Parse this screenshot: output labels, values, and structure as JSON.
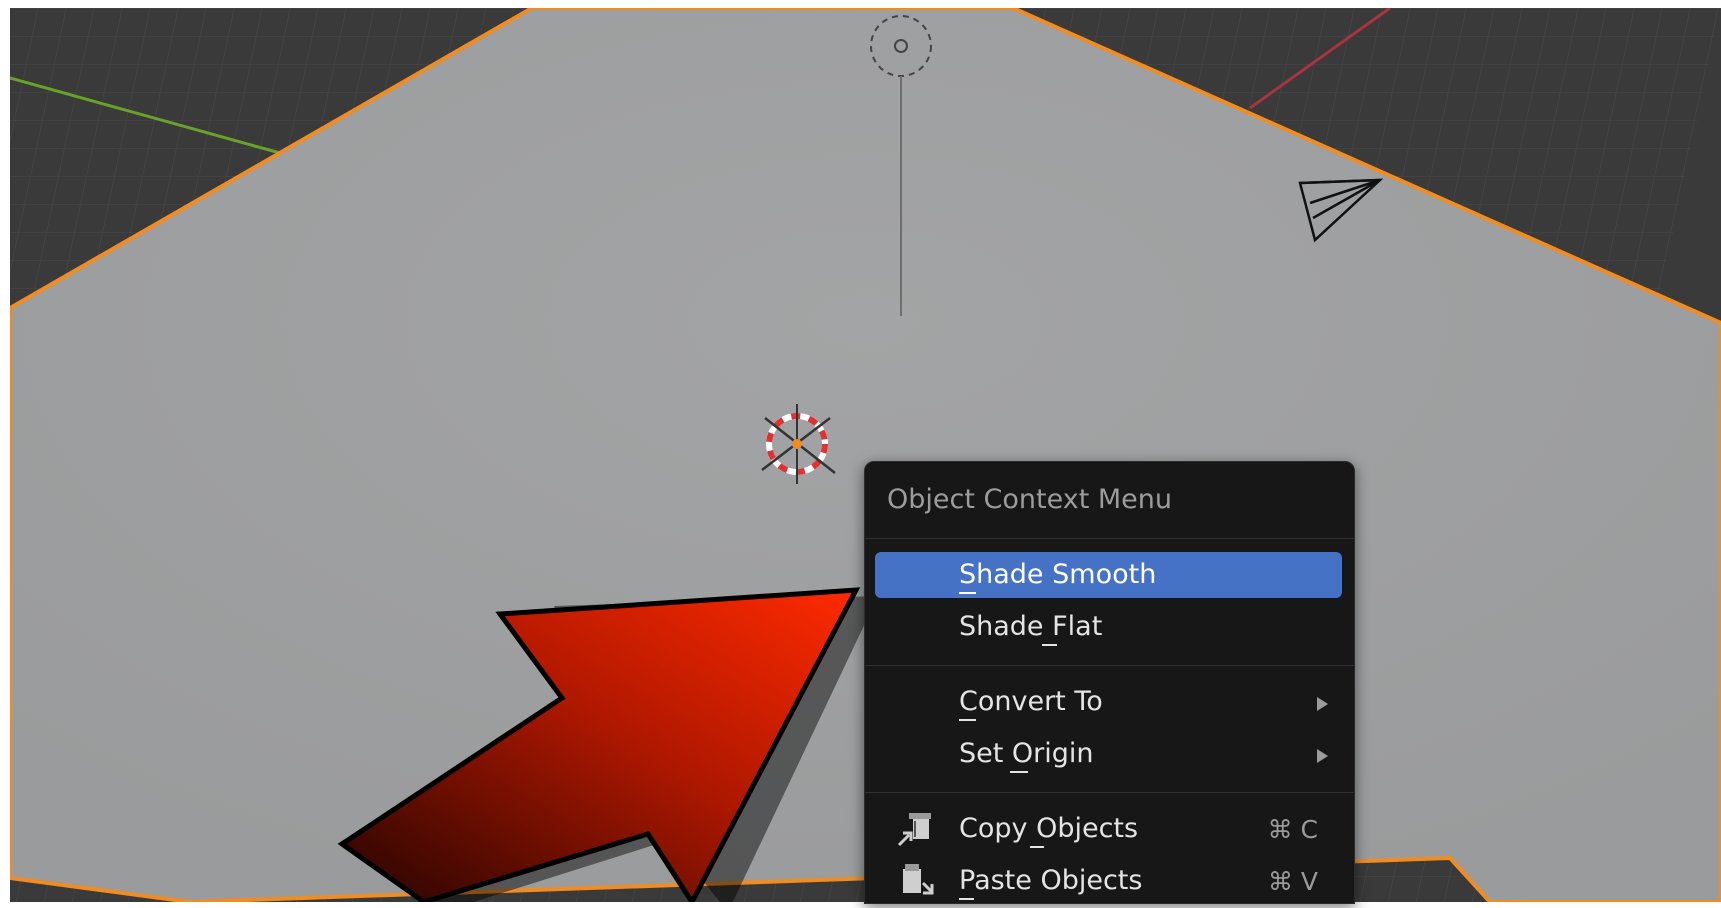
{
  "viewport": {
    "floor_color": "#3a3a3a",
    "plane_color": "#9c9d9e",
    "outline_color": "#f08c22",
    "x_axis_color": "#a8343d",
    "y_axis_color": "#69a12a"
  },
  "arrow": {
    "start_color": "#240400",
    "end_color": "#ff2a00"
  },
  "context_menu": {
    "title": "Object Context Menu",
    "items": [
      {
        "label": "Shade Smooth",
        "mnemonic": "S",
        "active": true
      },
      {
        "label": "Shade Flat",
        "mnemonic": "F"
      },
      {
        "label": "Convert To",
        "mnemonic": "C",
        "submenu": true
      },
      {
        "label": "Set Origin",
        "mnemonic": "O",
        "submenu": true
      },
      {
        "label": "Copy Objects",
        "mnemonic": "y",
        "shortcut": "⌘ C",
        "icon": "copy-objects-icon"
      },
      {
        "label": "Paste Objects",
        "mnemonic": "P",
        "shortcut": "⌘ V",
        "icon": "paste-objects-icon"
      }
    ],
    "active_color": "#4572c4"
  }
}
